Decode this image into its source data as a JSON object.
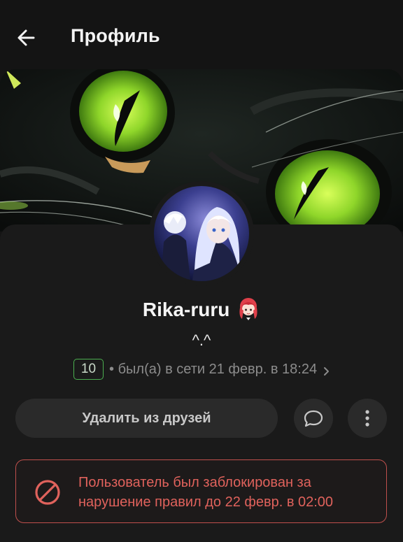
{
  "header": {
    "title": "Профиль",
    "back_icon": "arrow-left-icon"
  },
  "profile": {
    "name": "Rika-ruru",
    "name_emoji": "red-haired-girl-emoji",
    "status": "^.^",
    "level": "10",
    "last_seen": "• был(а) в сети 21 февр. в 18:24"
  },
  "actions": {
    "remove_friend_label": "Удалить из друзей",
    "message_icon": "chat-bubble-icon",
    "more_icon": "more-vertical-icon"
  },
  "ban_notice": {
    "text": "Пользователь был заблокирован за нарушение правил до 22 февр. в 02:00",
    "icon": "prohibited-icon"
  },
  "colors": {
    "background": "#141414",
    "card": "#1a1a1a",
    "level_border": "#4caf50",
    "ban_red": "#e0625c",
    "button_bg": "#2a2a2a"
  }
}
